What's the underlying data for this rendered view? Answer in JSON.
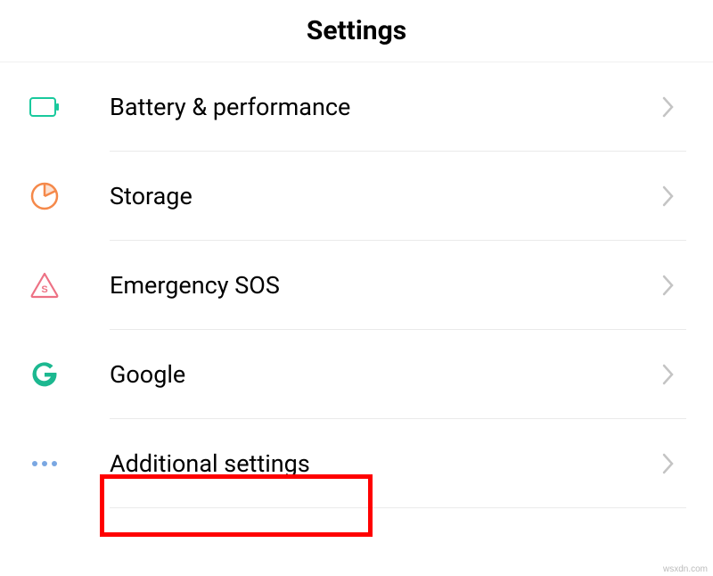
{
  "header": {
    "title": "Settings"
  },
  "items": [
    {
      "icon": "battery-icon",
      "label": "Battery & performance",
      "color": "#19c99d"
    },
    {
      "icon": "storage-icon",
      "label": "Storage",
      "color": "#f5894a"
    },
    {
      "icon": "sos-icon",
      "label": "Emergency SOS",
      "color": "#ed7184"
    },
    {
      "icon": "google-icon",
      "label": "Google",
      "color": "#1cb890"
    },
    {
      "icon": "more-icon",
      "label": "Additional settings",
      "color": "#7aa7e2"
    }
  ],
  "watermark": "wsxdn.com",
  "chevron_color": "#c4c4c4"
}
